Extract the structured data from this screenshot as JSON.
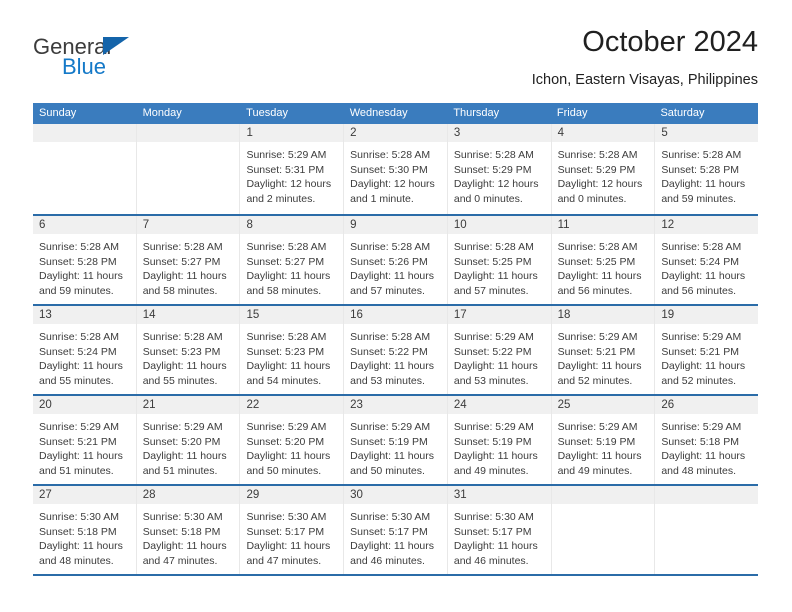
{
  "brand": {
    "name_part1": "General",
    "name_part2": "Blue",
    "triangle_icon": "triangle-icon",
    "colors": {
      "dark": "#3c3c3c",
      "blue": "#1479c8",
      "triangle": "#1464aa"
    }
  },
  "header": {
    "title": "October 2024",
    "subtitle": "Ichon, Eastern Visayas, Philippines"
  },
  "calendar": {
    "accent_color": "#3a7cbe",
    "separator_color": "#2b6ca8",
    "day_band_color": "#f0f0f0",
    "weekdays": [
      "Sunday",
      "Monday",
      "Tuesday",
      "Wednesday",
      "Thursday",
      "Friday",
      "Saturday"
    ],
    "labels": {
      "sunrise": "Sunrise:",
      "sunset": "Sunset:",
      "daylight": "Daylight:"
    },
    "weeks": [
      [
        {
          "day": "",
          "empty": true
        },
        {
          "day": "",
          "empty": true
        },
        {
          "day": "1",
          "sunrise": "Sunrise: 5:29 AM",
          "sunset": "Sunset: 5:31 PM",
          "daylight_line1": "Daylight: 12 hours",
          "daylight_line2": "and 2 minutes."
        },
        {
          "day": "2",
          "sunrise": "Sunrise: 5:28 AM",
          "sunset": "Sunset: 5:30 PM",
          "daylight_line1": "Daylight: 12 hours",
          "daylight_line2": "and 1 minute."
        },
        {
          "day": "3",
          "sunrise": "Sunrise: 5:28 AM",
          "sunset": "Sunset: 5:29 PM",
          "daylight_line1": "Daylight: 12 hours",
          "daylight_line2": "and 0 minutes."
        },
        {
          "day": "4",
          "sunrise": "Sunrise: 5:28 AM",
          "sunset": "Sunset: 5:29 PM",
          "daylight_line1": "Daylight: 12 hours",
          "daylight_line2": "and 0 minutes."
        },
        {
          "day": "5",
          "sunrise": "Sunrise: 5:28 AM",
          "sunset": "Sunset: 5:28 PM",
          "daylight_line1": "Daylight: 11 hours",
          "daylight_line2": "and 59 minutes."
        }
      ],
      [
        {
          "day": "6",
          "sunrise": "Sunrise: 5:28 AM",
          "sunset": "Sunset: 5:28 PM",
          "daylight_line1": "Daylight: 11 hours",
          "daylight_line2": "and 59 minutes."
        },
        {
          "day": "7",
          "sunrise": "Sunrise: 5:28 AM",
          "sunset": "Sunset: 5:27 PM",
          "daylight_line1": "Daylight: 11 hours",
          "daylight_line2": "and 58 minutes."
        },
        {
          "day": "8",
          "sunrise": "Sunrise: 5:28 AM",
          "sunset": "Sunset: 5:27 PM",
          "daylight_line1": "Daylight: 11 hours",
          "daylight_line2": "and 58 minutes."
        },
        {
          "day": "9",
          "sunrise": "Sunrise: 5:28 AM",
          "sunset": "Sunset: 5:26 PM",
          "daylight_line1": "Daylight: 11 hours",
          "daylight_line2": "and 57 minutes."
        },
        {
          "day": "10",
          "sunrise": "Sunrise: 5:28 AM",
          "sunset": "Sunset: 5:25 PM",
          "daylight_line1": "Daylight: 11 hours",
          "daylight_line2": "and 57 minutes."
        },
        {
          "day": "11",
          "sunrise": "Sunrise: 5:28 AM",
          "sunset": "Sunset: 5:25 PM",
          "daylight_line1": "Daylight: 11 hours",
          "daylight_line2": "and 56 minutes."
        },
        {
          "day": "12",
          "sunrise": "Sunrise: 5:28 AM",
          "sunset": "Sunset: 5:24 PM",
          "daylight_line1": "Daylight: 11 hours",
          "daylight_line2": "and 56 minutes."
        }
      ],
      [
        {
          "day": "13",
          "sunrise": "Sunrise: 5:28 AM",
          "sunset": "Sunset: 5:24 PM",
          "daylight_line1": "Daylight: 11 hours",
          "daylight_line2": "and 55 minutes."
        },
        {
          "day": "14",
          "sunrise": "Sunrise: 5:28 AM",
          "sunset": "Sunset: 5:23 PM",
          "daylight_line1": "Daylight: 11 hours",
          "daylight_line2": "and 55 minutes."
        },
        {
          "day": "15",
          "sunrise": "Sunrise: 5:28 AM",
          "sunset": "Sunset: 5:23 PM",
          "daylight_line1": "Daylight: 11 hours",
          "daylight_line2": "and 54 minutes."
        },
        {
          "day": "16",
          "sunrise": "Sunrise: 5:28 AM",
          "sunset": "Sunset: 5:22 PM",
          "daylight_line1": "Daylight: 11 hours",
          "daylight_line2": "and 53 minutes."
        },
        {
          "day": "17",
          "sunrise": "Sunrise: 5:29 AM",
          "sunset": "Sunset: 5:22 PM",
          "daylight_line1": "Daylight: 11 hours",
          "daylight_line2": "and 53 minutes."
        },
        {
          "day": "18",
          "sunrise": "Sunrise: 5:29 AM",
          "sunset": "Sunset: 5:21 PM",
          "daylight_line1": "Daylight: 11 hours",
          "daylight_line2": "and 52 minutes."
        },
        {
          "day": "19",
          "sunrise": "Sunrise: 5:29 AM",
          "sunset": "Sunset: 5:21 PM",
          "daylight_line1": "Daylight: 11 hours",
          "daylight_line2": "and 52 minutes."
        }
      ],
      [
        {
          "day": "20",
          "sunrise": "Sunrise: 5:29 AM",
          "sunset": "Sunset: 5:21 PM",
          "daylight_line1": "Daylight: 11 hours",
          "daylight_line2": "and 51 minutes."
        },
        {
          "day": "21",
          "sunrise": "Sunrise: 5:29 AM",
          "sunset": "Sunset: 5:20 PM",
          "daylight_line1": "Daylight: 11 hours",
          "daylight_line2": "and 51 minutes."
        },
        {
          "day": "22",
          "sunrise": "Sunrise: 5:29 AM",
          "sunset": "Sunset: 5:20 PM",
          "daylight_line1": "Daylight: 11 hours",
          "daylight_line2": "and 50 minutes."
        },
        {
          "day": "23",
          "sunrise": "Sunrise: 5:29 AM",
          "sunset": "Sunset: 5:19 PM",
          "daylight_line1": "Daylight: 11 hours",
          "daylight_line2": "and 50 minutes."
        },
        {
          "day": "24",
          "sunrise": "Sunrise: 5:29 AM",
          "sunset": "Sunset: 5:19 PM",
          "daylight_line1": "Daylight: 11 hours",
          "daylight_line2": "and 49 minutes."
        },
        {
          "day": "25",
          "sunrise": "Sunrise: 5:29 AM",
          "sunset": "Sunset: 5:19 PM",
          "daylight_line1": "Daylight: 11 hours",
          "daylight_line2": "and 49 minutes."
        },
        {
          "day": "26",
          "sunrise": "Sunrise: 5:29 AM",
          "sunset": "Sunset: 5:18 PM",
          "daylight_line1": "Daylight: 11 hours",
          "daylight_line2": "and 48 minutes."
        }
      ],
      [
        {
          "day": "27",
          "sunrise": "Sunrise: 5:30 AM",
          "sunset": "Sunset: 5:18 PM",
          "daylight_line1": "Daylight: 11 hours",
          "daylight_line2": "and 48 minutes."
        },
        {
          "day": "28",
          "sunrise": "Sunrise: 5:30 AM",
          "sunset": "Sunset: 5:18 PM",
          "daylight_line1": "Daylight: 11 hours",
          "daylight_line2": "and 47 minutes."
        },
        {
          "day": "29",
          "sunrise": "Sunrise: 5:30 AM",
          "sunset": "Sunset: 5:17 PM",
          "daylight_line1": "Daylight: 11 hours",
          "daylight_line2": "and 47 minutes."
        },
        {
          "day": "30",
          "sunrise": "Sunrise: 5:30 AM",
          "sunset": "Sunset: 5:17 PM",
          "daylight_line1": "Daylight: 11 hours",
          "daylight_line2": "and 46 minutes."
        },
        {
          "day": "31",
          "sunrise": "Sunrise: 5:30 AM",
          "sunset": "Sunset: 5:17 PM",
          "daylight_line1": "Daylight: 11 hours",
          "daylight_line2": "and 46 minutes."
        },
        {
          "day": "",
          "empty": true
        },
        {
          "day": "",
          "empty": true
        }
      ]
    ]
  }
}
